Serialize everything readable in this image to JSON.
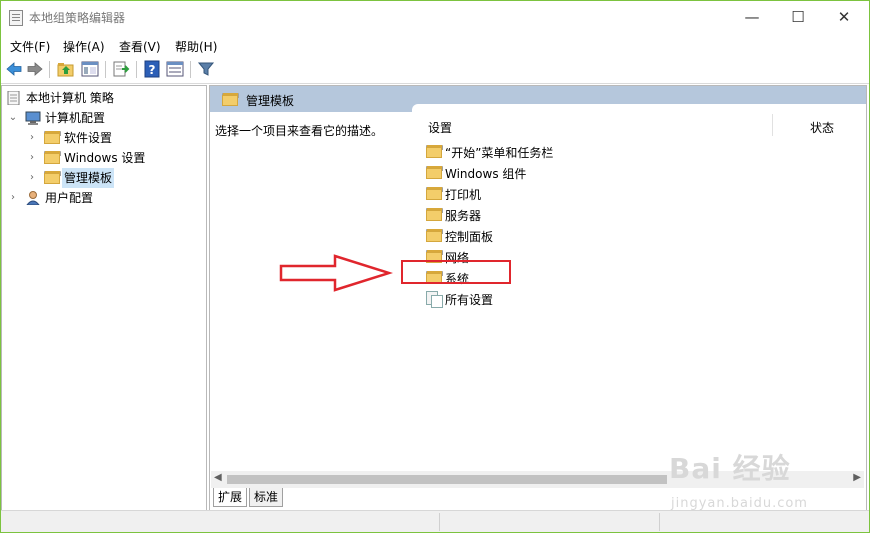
{
  "window": {
    "title": "本地组策略编辑器",
    "buttons": [
      "—",
      "☐",
      "✕"
    ]
  },
  "menu": [
    "文件(F)",
    "操作(A)",
    "查看(V)",
    "帮助(H)"
  ],
  "toolbar": {
    "icons": [
      "back-arrow-icon",
      "forward-arrow-icon",
      "up-folder-icon",
      "show-hide-tree-icon",
      "export-list-icon",
      "help-icon",
      "properties-icon",
      "filter-icon"
    ]
  },
  "tree": {
    "root": "本地计算机 策略",
    "computer_config": "计算机配置",
    "software_settings": "软件设置",
    "windows_settings": "Windows 设置",
    "admin_templates": "管理模板",
    "user_config": "用户配置"
  },
  "right_pane": {
    "header_title": "管理模板",
    "description": "选择一个项目来查看它的描述。",
    "columns": {
      "setting": "设置",
      "status": "状态"
    },
    "items": [
      "“开始”菜单和任务栏",
      "Windows 组件",
      "打印机",
      "服务器",
      "控制面板",
      "网络",
      "系统",
      "所有设置"
    ]
  },
  "tabs": {
    "extended": "扩展",
    "standard": "标准"
  },
  "watermark": {
    "brand": "Bai 经验",
    "url": "jingyan.baidu.com"
  },
  "colors": {
    "accent_border": "#7cc33f",
    "pane_header": "#b5c7dc",
    "annotation": "#e0262d",
    "selection": "#cce4f7"
  }
}
